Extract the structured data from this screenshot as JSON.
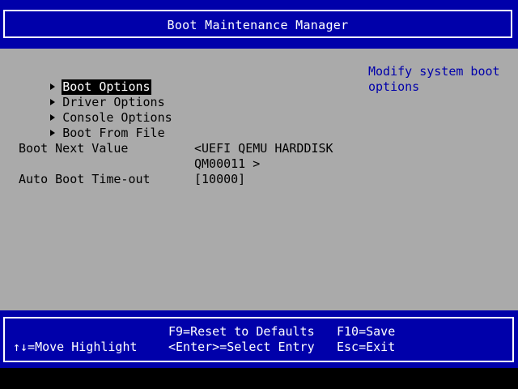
{
  "header": {
    "title": "Boot Maintenance Manager"
  },
  "menu": {
    "items": [
      {
        "label": "Boot Options",
        "selected": true
      },
      {
        "label": "Driver Options",
        "selected": false
      },
      {
        "label": "Console Options",
        "selected": false
      },
      {
        "label": "Boot From File",
        "selected": false
      }
    ]
  },
  "settings": {
    "boot_next": {
      "label": "Boot Next Value",
      "value_line1": "<UEFI QEMU HARDDISK",
      "value_line2": "QM00011 >"
    },
    "auto_boot": {
      "label": "Auto Boot Time-out",
      "value": "[10000]"
    }
  },
  "help": {
    "text": "Modify system boot options"
  },
  "footer": {
    "reset": "F9=Reset to Defaults",
    "save": "F10=Save",
    "move": "↑↓=Move Highlight",
    "select": "<Enter>=Select Entry",
    "exit": "Esc=Exit"
  },
  "colors": {
    "header_bg": "#0000aa",
    "body_bg": "#aaaaaa",
    "help_text": "#0000aa",
    "selection_bg": "#000000",
    "selection_fg": "#ffffff"
  }
}
